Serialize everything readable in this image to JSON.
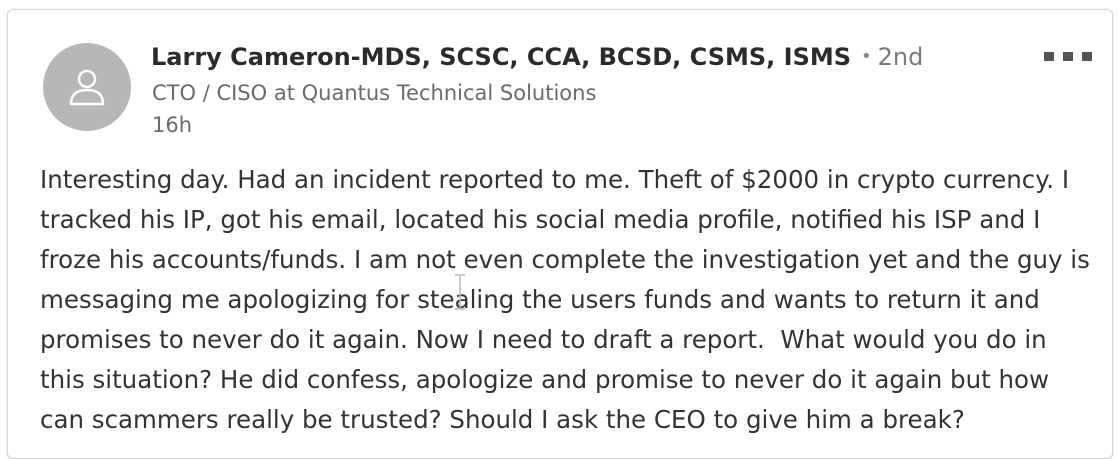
{
  "post": {
    "author": {
      "name": "Larry Cameron-MDS, SCSC, CCA, BCSD, CSMS, ISMS",
      "separator": "•",
      "connection_degree": "2nd",
      "headline": "CTO / CISO at Quantus Technical Solutions",
      "avatar_icon": "person-silhouette-icon"
    },
    "timestamp": "16h",
    "body": "Interesting day. Had an incident reported to me. Theft of $2000 in crypto currency. I tracked his IP, got his email, located his social media profile, notified his ISP and I froze his accounts/funds. I am not even complete the investigation yet and the guy is messaging me apologizing for stealing the users funds and wants to return it and promises to never do it again. Now I need to draft a report.  What would you do in this situation? He did confess, apologize and promise to never do it again but how can scammers really be trusted? Should I ask the CEO to give him a break?",
    "controls": {
      "more_icon": "more-options-icon"
    }
  },
  "colors": {
    "avatar_bg": "#b7b7b7",
    "name_text": "#2b2b2b",
    "meta_text": "#6a6a6a",
    "body_text": "#333333"
  }
}
